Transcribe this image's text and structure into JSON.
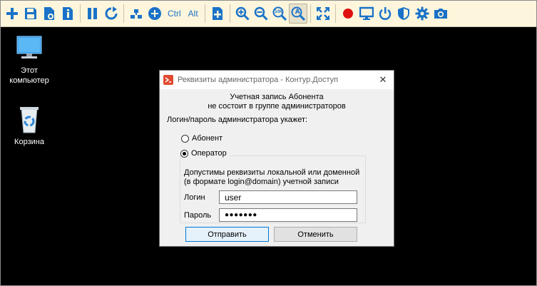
{
  "toolbar": {
    "buttons": [
      {
        "name": "add-icon"
      },
      {
        "name": "save-icon"
      },
      {
        "name": "file-settings-icon"
      },
      {
        "name": "file-info-icon"
      },
      {
        "name": "pause-icon"
      },
      {
        "name": "refresh-icon"
      },
      {
        "name": "network-icon"
      },
      {
        "name": "windows-key-icon"
      },
      {
        "name": "ctrl-key",
        "label": "Ctrl"
      },
      {
        "name": "alt-key",
        "label": "Alt"
      },
      {
        "name": "expand-icon"
      },
      {
        "name": "zoom-in-icon"
      },
      {
        "name": "zoom-out-icon"
      },
      {
        "name": "zoom-100-icon",
        "label": "100"
      },
      {
        "name": "zoom-auto-icon",
        "label": "A"
      },
      {
        "name": "fullscreen-icon"
      },
      {
        "name": "record-icon"
      },
      {
        "name": "monitor-icon"
      },
      {
        "name": "power-icon"
      },
      {
        "name": "shield-icon"
      },
      {
        "name": "gear-icon"
      },
      {
        "name": "camera-icon"
      }
    ],
    "record_color": "#e01010",
    "accent": "#1a72c8"
  },
  "desktop": {
    "icons": [
      {
        "name": "this-pc-icon",
        "label_line1": "Этот",
        "label_line2": "компьютер"
      },
      {
        "name": "recycle-bin-icon",
        "label_line1": "Корзина",
        "label_line2": ""
      }
    ]
  },
  "dialog": {
    "title": "Реквизиты администратора - Контур.Доступ",
    "message_line1": "Учетная запись Абонента",
    "message_line2": "не состоит в группе администраторов",
    "prompt": "Логин/пароль администратора укажет:",
    "option_subscriber": "Абонент",
    "option_operator": "Оператор",
    "selected": "Оператор",
    "hint_line1": "Допустимы реквизиты локальной или доменной",
    "hint_line2": "(в формате login@domain) учетной записи",
    "login_label": "Логин",
    "login_value": "user",
    "password_label": "Пароль",
    "password_value": "●●●●●●●",
    "submit_label": "Отправить",
    "cancel_label": "Отменить"
  }
}
